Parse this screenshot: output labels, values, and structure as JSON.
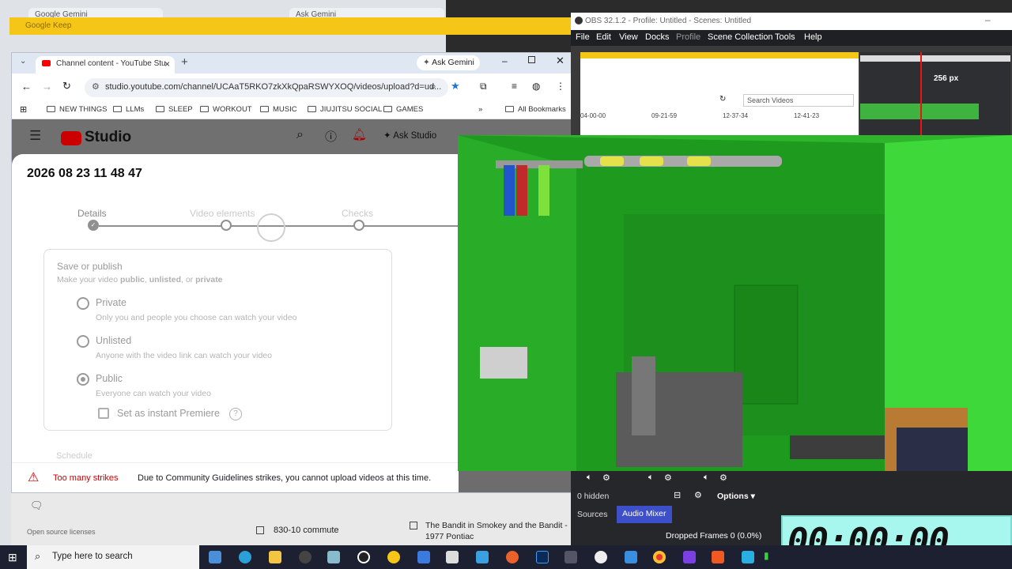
{
  "back_window": {
    "tab1": "Google Gemini",
    "tab2": "Ask Gemini"
  },
  "keep": {
    "title": "Google Keep"
  },
  "chrome": {
    "tab_title": "Channel content - YouTube Stu",
    "tab_close": "×",
    "new_tab": "+",
    "gemini_chip": "Ask Gemini",
    "url": "studio.youtube.com/channel/UCAaT5RKO7zkXkQpaRSWYXOQ/videos/upload?d=ud...",
    "bookmarks": [
      "NEW THINGS",
      "LLMs",
      "SLEEP",
      "WORKOUT",
      "MUSIC",
      "JIUJITSU SOCIAL",
      "GAMES"
    ],
    "all_bookmarks": "All Bookmarks",
    "more_bookmarks": "»"
  },
  "studio": {
    "logo": "Studio",
    "ask_studio": "Ask Studio"
  },
  "dialog": {
    "title": "2026 08 23 11 48 47",
    "steps": [
      "Details",
      "Video elements",
      "Checks"
    ],
    "save_title": "Save or publish",
    "save_sub_pre": "Make your video ",
    "save_sub_public": "public",
    "save_sub_sep1": ", ",
    "save_sub_unlisted": "unlisted",
    "save_sub_sep2": ", or ",
    "save_sub_private": "private",
    "options": [
      {
        "label": "Private",
        "sub": "Only you and people you choose can watch your video"
      },
      {
        "label": "Unlisted",
        "sub": "Anyone with the video link can watch your video"
      },
      {
        "label": "Public",
        "sub": "Everyone can watch your video"
      }
    ],
    "premiere": "Set as instant Premiere",
    "schedule": "Schedule",
    "strike_label": "Too many strikes",
    "strike_msg": "Due to Community Guidelines strikes, you cannot upload videos at this time."
  },
  "behind": {
    "licenses": "Open source licenses",
    "item1": "830-10 commute",
    "item2": "The Bandit in Smokey and the Bandit - 1977 Pontiac"
  },
  "obs": {
    "title": "OBS 32.1.2 - Profile: Untitled - Scenes: Untitled",
    "menu": [
      "File",
      "Edit",
      "View",
      "Docks",
      "Profile",
      "Scene Collection",
      "Tools",
      "Help"
    ],
    "search_videos": "Search Videos",
    "dates": [
      "04-00-00",
      "09-21-59",
      "12-37-34",
      "12-41-23"
    ],
    "px_readout": "256 px",
    "hidden": "0 hidden",
    "options": "Options",
    "tab_sources": "Sources",
    "tab_mixer": "Audio Mixer",
    "dropped": "Dropped Frames 0 (0.0%)"
  },
  "timer": "00:00:00",
  "taskbar": {
    "search": "Type here to search"
  },
  "colors": {
    "youtube_red": "#ff0000",
    "strike_red": "#cc0000",
    "obs_mixer_active": "#3d4fc9",
    "keep_yellow": "#f5c518"
  }
}
